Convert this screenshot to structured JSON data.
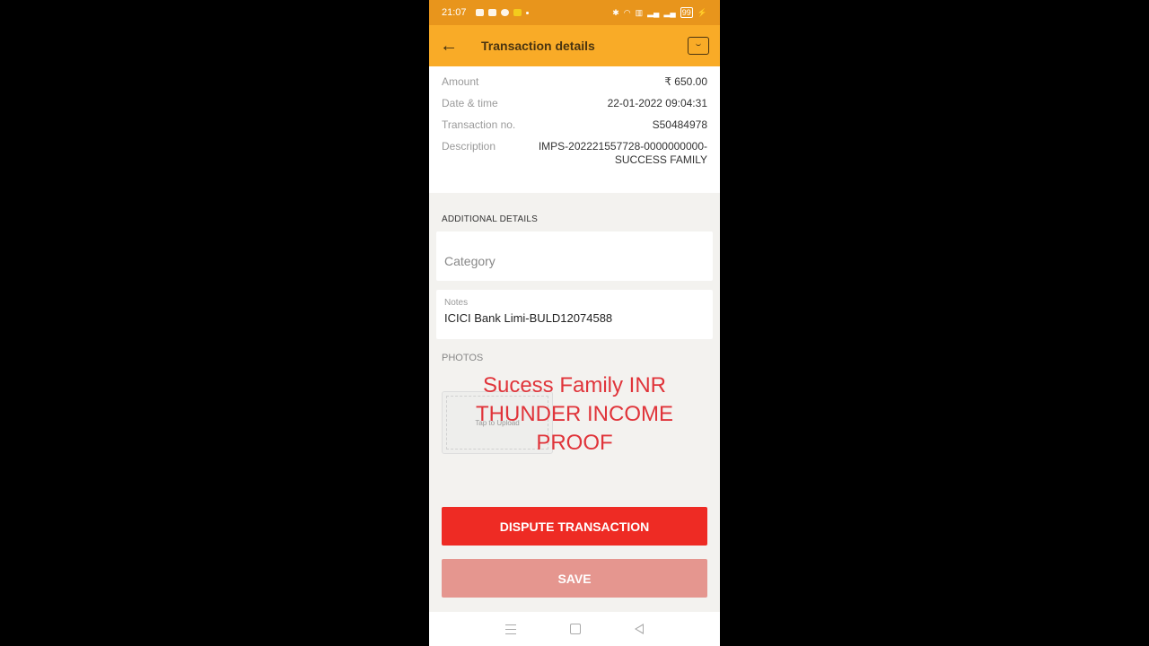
{
  "status_bar": {
    "time": "21:07",
    "battery": "99"
  },
  "app_bar": {
    "back_icon": "arrow-left-icon",
    "title": "Transaction details",
    "chat_icon": "chat-icon"
  },
  "details": [
    {
      "label": "Amount",
      "value": "₹ 650.00"
    },
    {
      "label": "Date & time",
      "value": "22-01-2022 09:04:31"
    },
    {
      "label": "Transaction no.",
      "value": "S50484978"
    },
    {
      "label": "Description",
      "value": "IMPS-202221557728-0000000000-SUCCESS FAMILY"
    }
  ],
  "additional": {
    "title": "ADDITIONAL DETAILS",
    "category_placeholder": "Category",
    "notes_label": "Notes",
    "notes_value": "ICICI Bank Limi-BULD12074588"
  },
  "photos": {
    "title": "PHOTOS",
    "upload_label": "Tap to Upload"
  },
  "overlay": {
    "line1": "Sucess Family INR",
    "line2": "THUNDER INCOME",
    "line3": "PROOF"
  },
  "buttons": {
    "dispute": "DISPUTE TRANSACTION",
    "save": "SAVE"
  },
  "colors": {
    "appbar": "#f9ab27",
    "statusbar": "#e8951c",
    "dispute": "#ee2b24",
    "save": "#e5968f",
    "overlay_text": "#e0343a"
  }
}
